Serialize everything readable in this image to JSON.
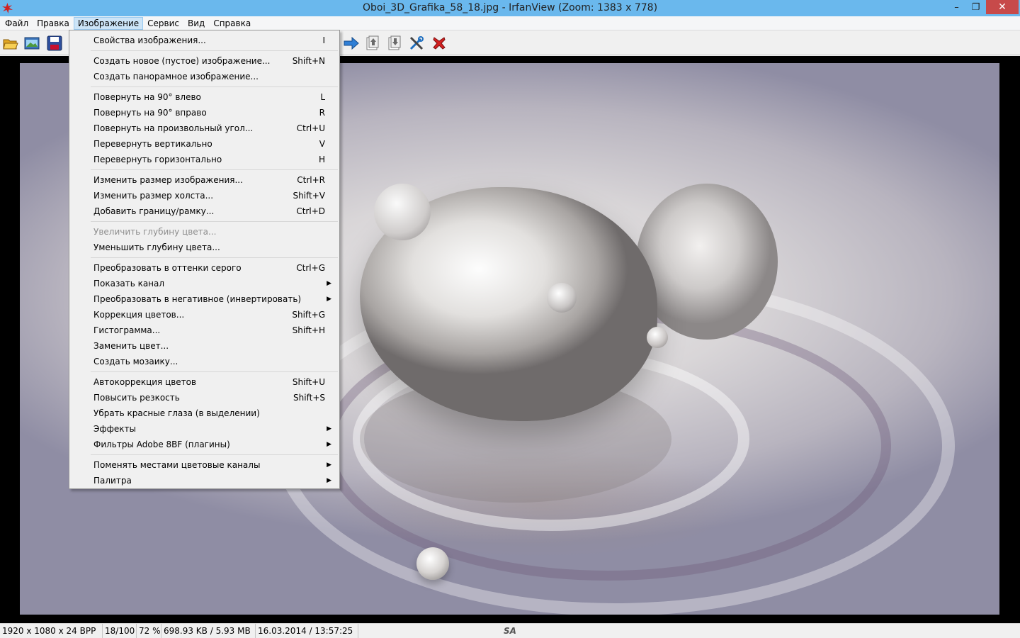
{
  "window": {
    "title": "Oboi_3D_Grafika_58_18.jpg - IrfanView (Zoom: 1383 x 778)",
    "minimize": "–",
    "maximize": "❐",
    "close": "✕"
  },
  "menubar": {
    "items": [
      "Файл",
      "Правка",
      "Изображение",
      "Сервис",
      "Вид",
      "Справка"
    ],
    "active": "Изображение"
  },
  "toolbar": {
    "icons": [
      "open-folder-icon",
      "thumbnails-icon",
      "save-icon",
      "next-arrow-icon",
      "move-up-icon",
      "move-down-icon",
      "settings-tools-icon",
      "exit-icon"
    ]
  },
  "dropdown": {
    "groups": [
      [
        {
          "label": "Свойства изображения...",
          "shortcut": "I"
        }
      ],
      [
        {
          "label": "Создать новое (пустое) изображение...",
          "shortcut": "Shift+N"
        },
        {
          "label": "Создать панорамное изображение...",
          "shortcut": ""
        }
      ],
      [
        {
          "label": "Повернуть на 90° влево",
          "shortcut": "L"
        },
        {
          "label": "Повернуть на 90° вправо",
          "shortcut": "R"
        },
        {
          "label": "Повернуть на произвольный угол...",
          "shortcut": "Ctrl+U"
        },
        {
          "label": "Перевернуть вертикально",
          "shortcut": "V"
        },
        {
          "label": "Перевернуть горизонтально",
          "shortcut": "H"
        }
      ],
      [
        {
          "label": "Изменить размер изображения...",
          "shortcut": "Ctrl+R"
        },
        {
          "label": "Изменить размер холста...",
          "shortcut": "Shift+V"
        },
        {
          "label": "Добавить границу/рамку...",
          "shortcut": "Ctrl+D"
        }
      ],
      [
        {
          "label": "Увеличить глубину цвета...",
          "shortcut": "",
          "disabled": true
        },
        {
          "label": "Уменьшить глубину цвета...",
          "shortcut": ""
        }
      ],
      [
        {
          "label": "Преобразовать в оттенки серого",
          "shortcut": "Ctrl+G"
        },
        {
          "label": "Показать канал",
          "shortcut": "",
          "submenu": true
        },
        {
          "label": "Преобразовать в негативное (инвертировать)",
          "shortcut": "",
          "submenu": true
        },
        {
          "label": "Коррекция цветов...",
          "shortcut": "Shift+G"
        },
        {
          "label": "Гистограмма...",
          "shortcut": "Shift+H"
        },
        {
          "label": "Заменить цвет...",
          "shortcut": ""
        },
        {
          "label": "Создать мозаику...",
          "shortcut": ""
        }
      ],
      [
        {
          "label": "Автокоррекция цветов",
          "shortcut": "Shift+U"
        },
        {
          "label": "Повысить резкость",
          "shortcut": "Shift+S"
        },
        {
          "label": "Убрать красные глаза (в выделении)",
          "shortcut": ""
        },
        {
          "label": "Эффекты",
          "shortcut": "",
          "submenu": true
        },
        {
          "label": "Фильтры Adobe 8BF (плагины)",
          "shortcut": "",
          "submenu": true
        }
      ],
      [
        {
          "label": "Поменять местами цветовые каналы",
          "shortcut": "",
          "submenu": true
        },
        {
          "label": "Палитра",
          "shortcut": "",
          "submenu": true
        }
      ]
    ],
    "submenu_arrow": "▶"
  },
  "statusbar": {
    "dimensions": "1920 x 1080 x 24 BPP",
    "index": "18/100",
    "zoom": "72 %",
    "size": "698.93 KB / 5.93 MB",
    "datetime": "16.03.2014 / 13:57:25",
    "logo": "SA"
  }
}
